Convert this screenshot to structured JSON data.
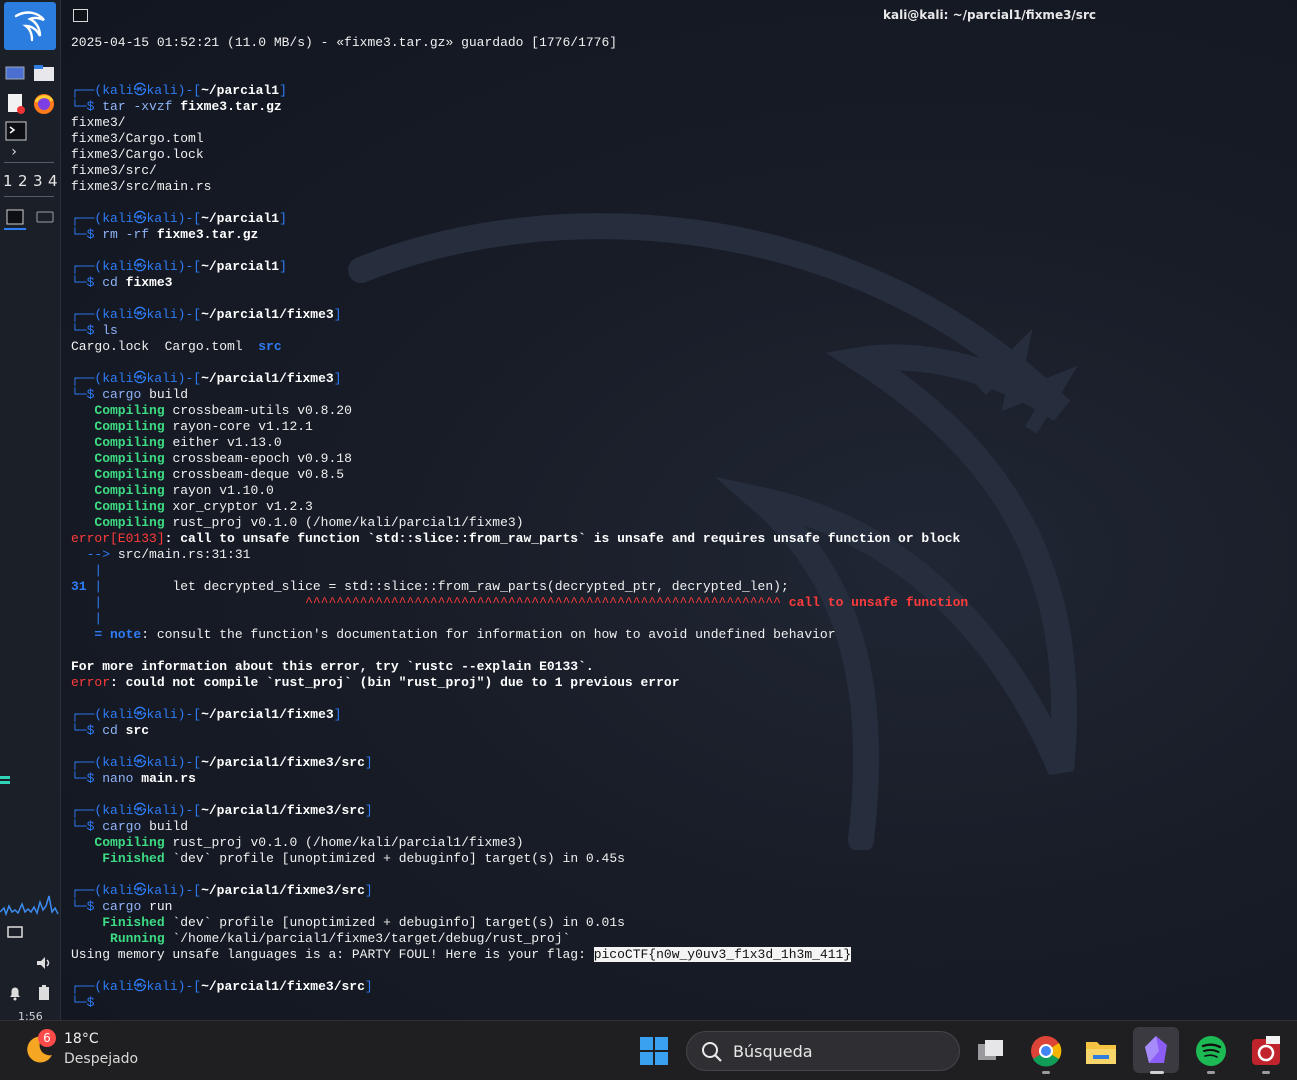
{
  "window": {
    "title": "kali@kali: ~/parcial1/fixme3/src"
  },
  "left_panel": {
    "workspaces": [
      "1",
      "2",
      "3",
      "4"
    ],
    "clock": "1:56"
  },
  "prompt": {
    "user": "kali",
    "host": "kali",
    "symbol": "$"
  },
  "terminal": {
    "download_line": "2025-04-15 01:52:21 (11.0 MB/s) - «fixme3.tar.gz» guardado [1776/1776]",
    "blocks": [
      {
        "dir": "~/parcial1",
        "cmd": "tar",
        "args": "-xvzf",
        "target": "fixme3.tar.gz",
        "output": [
          "fixme3/",
          "fixme3/Cargo.toml",
          "fixme3/Cargo.lock",
          "fixme3/src/",
          "fixme3/src/main.rs"
        ]
      },
      {
        "dir": "~/parcial1",
        "cmd": "rm",
        "args": "-rf",
        "target": "fixme3.tar.gz"
      },
      {
        "dir": "~/parcial1",
        "cmd": "cd",
        "target": "fixme3"
      },
      {
        "dir": "~/parcial1/fixme3",
        "cmd": "ls",
        "ls_files": [
          "Cargo.lock",
          "Cargo.toml"
        ],
        "ls_dir": "src"
      },
      {
        "dir": "~/parcial1/fixme3",
        "cmd": "cargo",
        "args": "build"
      },
      {
        "dir": "~/parcial1/fixme3",
        "cmd": "cd",
        "target": "src"
      },
      {
        "dir": "~/parcial1/fixme3/src",
        "cmd": "nano",
        "target": "main.rs"
      },
      {
        "dir": "~/parcial1/fixme3/src",
        "cmd": "cargo",
        "args": "build"
      },
      {
        "dir": "~/parcial1/fixme3/src",
        "cmd": "cargo",
        "args": "run"
      },
      {
        "dir": "~/parcial1/fixme3/src"
      }
    ],
    "compile_label": "Compiling",
    "finished_label": "Finished",
    "running_label": "Running",
    "compiling_crates": [
      "crossbeam-utils v0.8.20",
      "rayon-core v1.12.1",
      "either v1.13.0",
      "crossbeam-epoch v0.9.18",
      "crossbeam-deque v0.8.5",
      "rayon v1.10.0",
      "xor_cryptor v1.2.3",
      "rust_proj v0.1.0 (/home/kali/parcial1/fixme3)"
    ],
    "error_code": "error[E0133]",
    "error_message": ": call to unsafe function `std::slice::from_raw_parts` is unsafe and requires unsafe function or block",
    "error_location_arrow": "-->",
    "error_location": "src/main.rs:31:31",
    "error_line_number": "31",
    "error_code_line": "        let decrypted_slice = std::slice::from_raw_parts(decrypted_ptr, decrypted_len);",
    "error_carets": "^^^^^^^^^^^^^^^^^^^^^^^^^^^^^^^^^^^^^^^^^^^^^^^^^^^^^^^^^^^^^",
    "error_caret_label": "call to unsafe function",
    "note_label": "= note",
    "note_text": ": consult the function's documentation for information on how to avoid undefined behavior",
    "more_info": "For more information about this error, try `rustc --explain E0133`.",
    "error_label": "error",
    "final_error": ": could not compile `rust_proj` (bin \"rust_proj\") due to 1 previous error",
    "build2_compiling": "rust_proj v0.1.0 (/home/kali/parcial1/fixme3)",
    "build2_finished": "`dev` profile [unoptimized + debuginfo] target(s) in 0.45s",
    "run_finished": "`dev` profile [unoptimized + debuginfo] target(s) in 0.01s",
    "run_running": "`/home/kali/parcial1/fixme3/target/debug/rust_proj`",
    "flag_prefix": "Using memory unsafe languages is a: PARTY FOUL! Here is your flag: ",
    "flag": "picoCTF{n0w_y0uv3_f1x3d_1h3m_411}"
  },
  "taskbar": {
    "weather_badge": "6",
    "weather_temp": "18°C",
    "weather_desc": "Despejado",
    "search_placeholder": "Búsqueda"
  }
}
